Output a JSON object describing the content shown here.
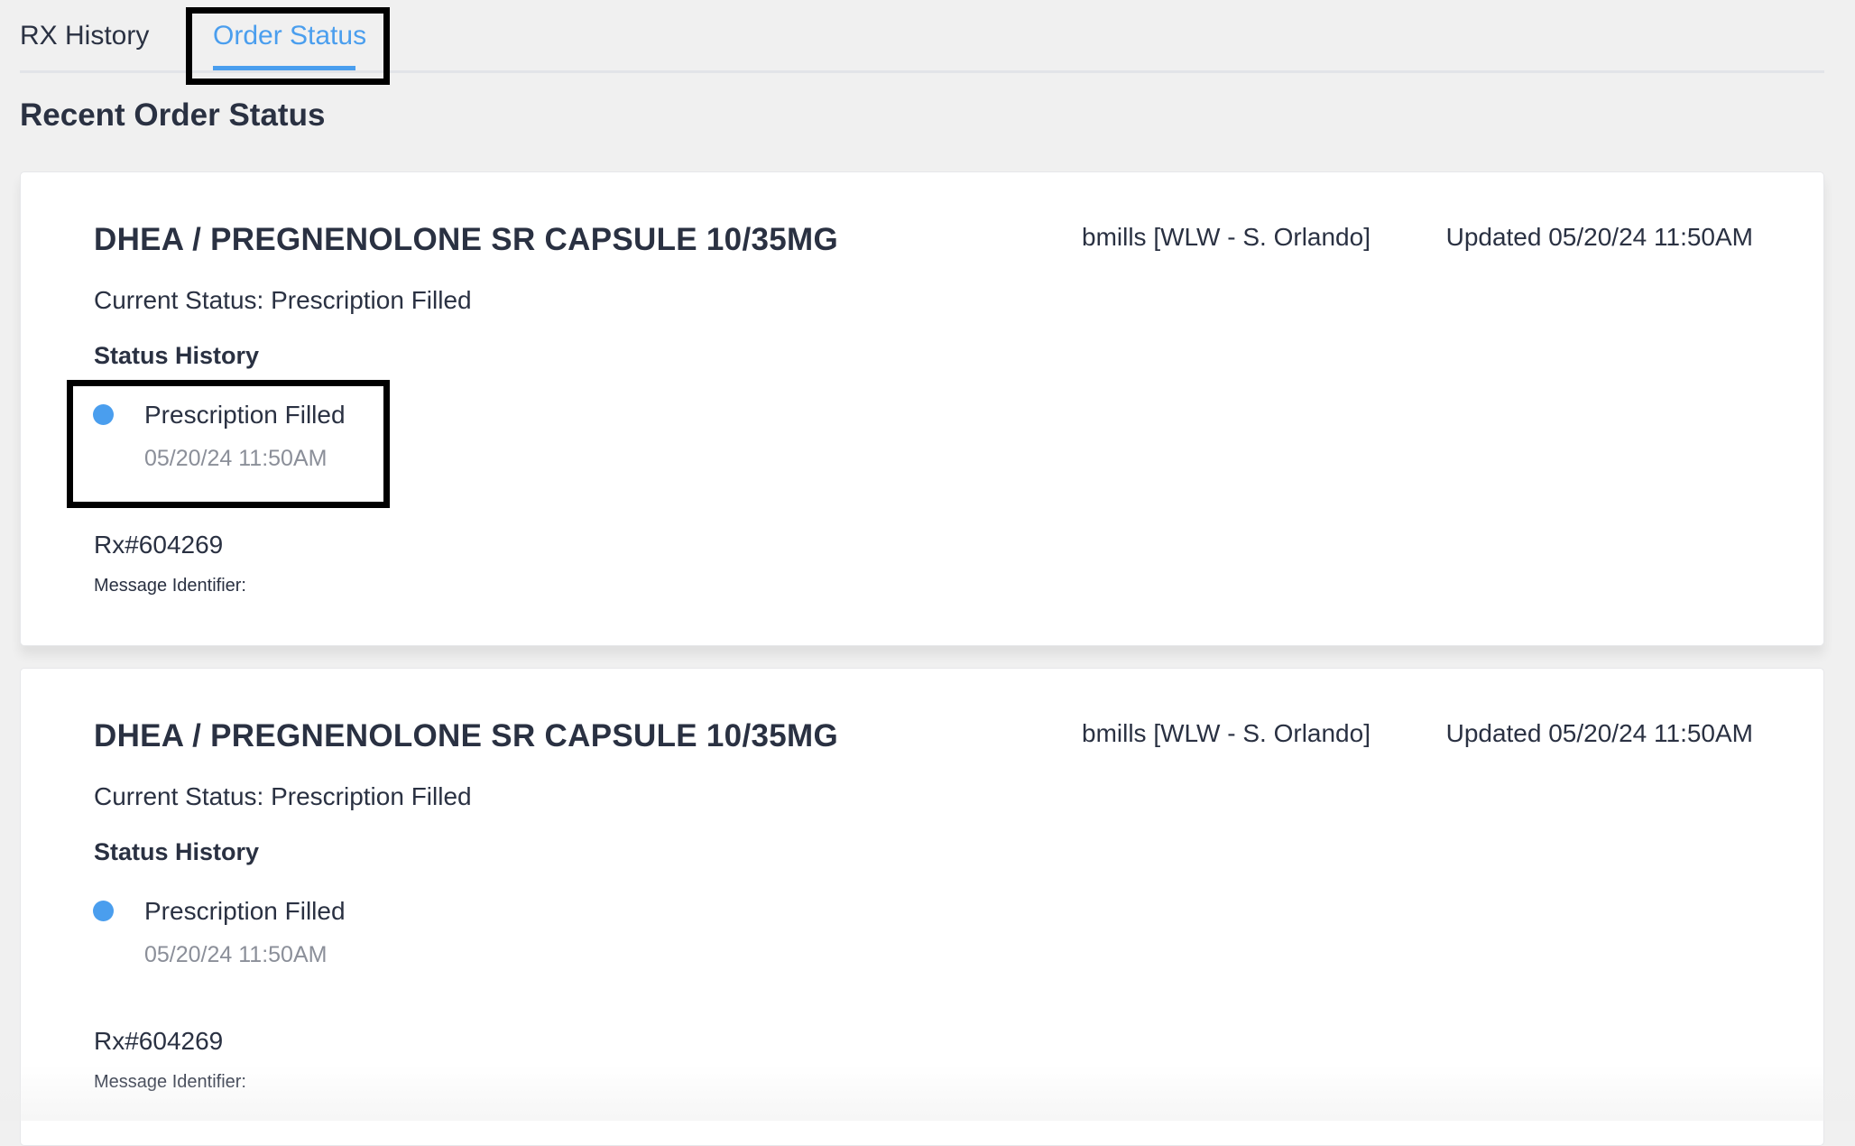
{
  "tabs": [
    {
      "label": "RX History",
      "active": false
    },
    {
      "label": "Order Status",
      "active": true
    }
  ],
  "page_title": "Recent Order Status",
  "colors": {
    "accent": "#4a9eee",
    "text": "#2a3142",
    "muted": "#8b8f99",
    "background": "#f0f0f0"
  },
  "orders": [
    {
      "drug": "DHEA / PREGNENOLONE SR CAPSULE 10/35MG",
      "user": "bmills [WLW - S. Orlando]",
      "updated": "Updated 05/20/24 11:50AM",
      "current_status": "Current Status: Prescription Filled",
      "history_heading": "Status History",
      "history": [
        {
          "label": "Prescription Filled",
          "time": "05/20/24 11:50AM"
        }
      ],
      "rx_number": "Rx#604269",
      "message_identifier": "Message Identifier:"
    },
    {
      "drug": "DHEA / PREGNENOLONE SR CAPSULE 10/35MG",
      "user": "bmills [WLW - S. Orlando]",
      "updated": "Updated 05/20/24 11:50AM",
      "current_status": "Current Status: Prescription Filled",
      "history_heading": "Status History",
      "history": [
        {
          "label": "Prescription Filled",
          "time": "05/20/24 11:50AM"
        }
      ],
      "rx_number": "Rx#604269",
      "message_identifier": "Message Identifier:"
    }
  ]
}
